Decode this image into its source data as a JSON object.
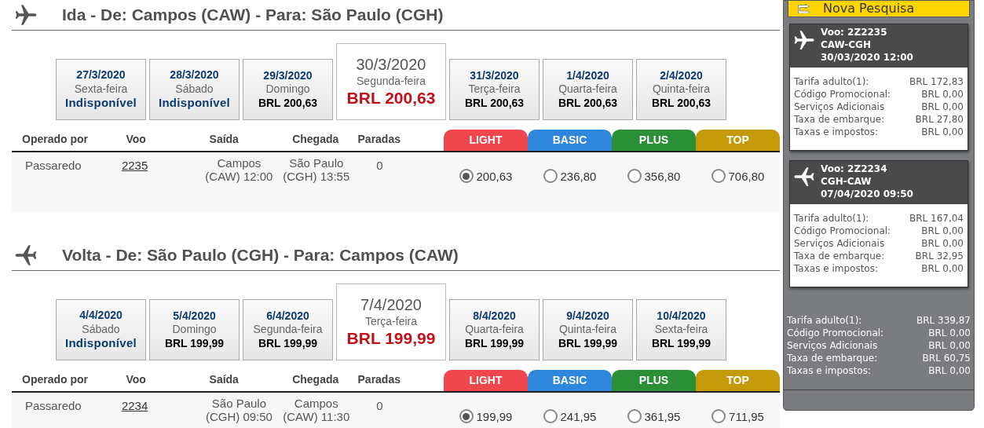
{
  "sections": [
    {
      "title": "Ida - De: Campos (CAW) - Para: São Paulo (CGH)",
      "kind": "outbound",
      "dates": [
        {
          "date": "27/3/2020",
          "weekday": "Sexta-feira",
          "price": "Indisponível",
          "available": false,
          "selected": false
        },
        {
          "date": "28/3/2020",
          "weekday": "Sábado",
          "price": "Indisponível",
          "available": false,
          "selected": false
        },
        {
          "date": "29/3/2020",
          "weekday": "Domingo",
          "price": "BRL 200,63",
          "available": true,
          "selected": false
        },
        {
          "date": "30/3/2020",
          "weekday": "Segunda-feira",
          "price": "BRL 200,63",
          "available": true,
          "selected": true
        },
        {
          "date": "31/3/2020",
          "weekday": "Terça-feira",
          "price": "BRL 200,63",
          "available": true,
          "selected": false
        },
        {
          "date": "1/4/2020",
          "weekday": "Quarta-feira",
          "price": "BRL 200,63",
          "available": true,
          "selected": false
        },
        {
          "date": "2/4/2020",
          "weekday": "Quinta-feira",
          "price": "BRL 200,63",
          "available": true,
          "selected": false
        }
      ],
      "columns": [
        "Operado por",
        "Voo",
        "Saída",
        "Chegada",
        "Paradas"
      ],
      "fares": [
        {
          "label": "LIGHT",
          "color": "#f0464d"
        },
        {
          "label": "BASIC",
          "color": "#2e87dd"
        },
        {
          "label": "PLUS",
          "color": "#2b8f38"
        },
        {
          "label": "TOP",
          "color": "#c49a08"
        }
      ],
      "rows": [
        {
          "operator": "Passaredo",
          "flight": "2235",
          "departure": "Campos (CAW) 12:00",
          "arrival": "São Paulo (CGH) 13:55",
          "stops": "0",
          "prices": [
            {
              "value": "200,63",
              "selected": true
            },
            {
              "value": "236,80",
              "selected": false
            },
            {
              "value": "356,80",
              "selected": false
            },
            {
              "value": "706,80",
              "selected": false
            }
          ]
        }
      ]
    },
    {
      "title": "Volta - De: São Paulo (CGH) - Para: Campos (CAW)",
      "kind": "return",
      "dates": [
        {
          "date": "4/4/2020",
          "weekday": "Sábado",
          "price": "Indisponível",
          "available": false,
          "selected": false
        },
        {
          "date": "5/4/2020",
          "weekday": "Domingo",
          "price": "BRL 199,99",
          "available": true,
          "selected": false
        },
        {
          "date": "6/4/2020",
          "weekday": "Segunda-feira",
          "price": "BRL 199,99",
          "available": true,
          "selected": false
        },
        {
          "date": "7/4/2020",
          "weekday": "Terça-feira",
          "price": "BRL 199,99",
          "available": true,
          "selected": true
        },
        {
          "date": "8/4/2020",
          "weekday": "Quarta-feira",
          "price": "BRL 199,99",
          "available": true,
          "selected": false
        },
        {
          "date": "9/4/2020",
          "weekday": "Quinta-feira",
          "price": "BRL 199,99",
          "available": true,
          "selected": false
        },
        {
          "date": "10/4/2020",
          "weekday": "Sexta-feira",
          "price": "BRL 199,99",
          "available": true,
          "selected": false
        }
      ],
      "columns": [
        "Operado por",
        "Voo",
        "Saída",
        "Chegada",
        "Paradas"
      ],
      "fares": [
        {
          "label": "LIGHT",
          "color": "#f0464d"
        },
        {
          "label": "BASIC",
          "color": "#2e87dd"
        },
        {
          "label": "PLUS",
          "color": "#2b8f38"
        },
        {
          "label": "TOP",
          "color": "#c49a08"
        }
      ],
      "rows": [
        {
          "operator": "Passaredo",
          "flight": "2234",
          "departure": "São Paulo (CGH) 09:50",
          "arrival": "Campos (CAW) 11:30",
          "stops": "0",
          "prices": [
            {
              "value": "199,99",
              "selected": true
            },
            {
              "value": "241,95",
              "selected": false
            },
            {
              "value": "361,95",
              "selected": false
            },
            {
              "value": "711,95",
              "selected": false
            }
          ]
        }
      ]
    }
  ],
  "sidebar": {
    "new_search": "Nova Pesquisa",
    "flights": [
      {
        "kind": "outbound",
        "flight": "Voo: 2Z2235",
        "route": "CAW-CGH",
        "datetime": "30/03/2020 12:00",
        "lines": [
          {
            "label": "Tarifa adulto(1):",
            "value": "BRL 172,83"
          },
          {
            "label": "Código Promocional:",
            "value": "BRL 0,00"
          },
          {
            "label": "Serviços Adicionais",
            "value": "BRL 0,00"
          },
          {
            "label": "Taxa de embarque:",
            "value": "BRL 27,80"
          },
          {
            "label": "Taxas e impostos:",
            "value": "BRL 0,00"
          }
        ]
      },
      {
        "kind": "return",
        "flight": "Voo: 2Z2234",
        "route": "CGH-CAW",
        "datetime": "07/04/2020 09:50",
        "lines": [
          {
            "label": "Tarifa adulto(1):",
            "value": "BRL 167,04"
          },
          {
            "label": "Código Promocional:",
            "value": "BRL 0,00"
          },
          {
            "label": "Serviços Adicionais",
            "value": "BRL 0,00"
          },
          {
            "label": "Taxa de embarque:",
            "value": "BRL 32,95"
          },
          {
            "label": "Taxas e impostos:",
            "value": "BRL 0,00"
          }
        ]
      }
    ],
    "totals": [
      {
        "label": "Tarifa adulto(1):",
        "value": "BRL 339,87"
      },
      {
        "label": "Código Promocional:",
        "value": "BRL 0,00"
      },
      {
        "label": "Serviços Adicionais",
        "value": "BRL 0,00"
      },
      {
        "label": "Taxa de embarque:",
        "value": "BRL 60,75"
      },
      {
        "label": "Taxas e impostos:",
        "value": "BRL 0,00"
      }
    ]
  }
}
